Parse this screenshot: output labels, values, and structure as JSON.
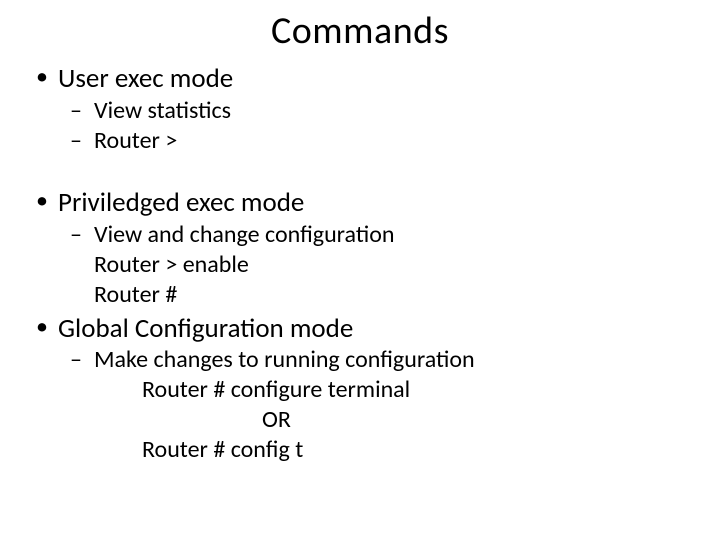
{
  "title": "Commands",
  "sections": [
    {
      "heading": "User exec mode",
      "items": [
        {
          "type": "dash",
          "text": "View statistics"
        },
        {
          "type": "dash",
          "text": "Router >"
        }
      ],
      "spacer_after": true
    },
    {
      "heading": "Priviledged exec mode",
      "items": [
        {
          "type": "dash",
          "text": "View and change configuration"
        },
        {
          "type": "plain",
          "text": "Router >  enable"
        },
        {
          "type": "plain",
          "text": "Router #"
        }
      ],
      "spacer_after": false
    },
    {
      "heading": "Global Configuration mode",
      "items": [
        {
          "type": "dash",
          "text": "Make changes to running configuration"
        }
      ],
      "sub_items": [
        {
          "text": "Router # configure  terminal",
          "class": ""
        },
        {
          "text": "OR",
          "class": "or-line"
        },
        {
          "text": "Router # config t",
          "class": ""
        }
      ],
      "spacer_after": false
    }
  ]
}
